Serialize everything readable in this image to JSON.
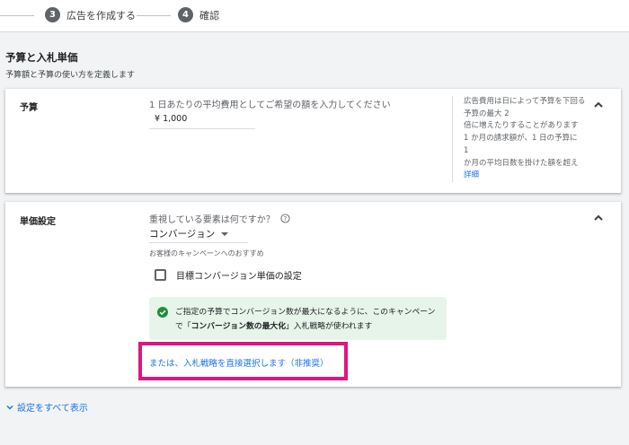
{
  "stepper": {
    "steps": [
      {
        "number": "3",
        "label": "広告を作成する"
      },
      {
        "number": "4",
        "label": "確認"
      }
    ]
  },
  "section": {
    "title": "予算と入札単価",
    "subtitle": "予算額と予算の使い方を定義します"
  },
  "budget": {
    "title": "予算",
    "hint": "1 日あたりの平均費用としてご希望の額を入力してください",
    "value": "¥ 1,000",
    "side_lines": [
      "広告費用は日によって予算を下回る",
      "予算の最大 2",
      "倍に増えたりすることがあります",
      "1 か月の請求額が、1 日の予算に",
      "1",
      "か月の平均日数を掛けた額を超え"
    ],
    "side_link": "詳細"
  },
  "bidding": {
    "title": "単価設定",
    "question": "重視している要素は何ですか？",
    "selected": "コンバージョン",
    "recommendation": "お客様のキャンペーンへのおすすめ",
    "checkbox_label": "目標コンバージョン単価の設定",
    "info_line1": "ご指定の予算でコンバージョン数が最大になるように、このキャンペーン",
    "info_prefix": "で「",
    "info_bold": "コンバージョン数の最大化",
    "info_suffix": "」入札戦略が使われます",
    "manual_link": "または、入札戦略を直接選択します（非推奨）"
  },
  "footer": {
    "show_all": "設定をすべて表示"
  },
  "colors": {
    "accent": "#1a73e8",
    "highlight": "#e0157f",
    "success": "#1e8e3e",
    "info_bg": "#e6f4ea"
  }
}
